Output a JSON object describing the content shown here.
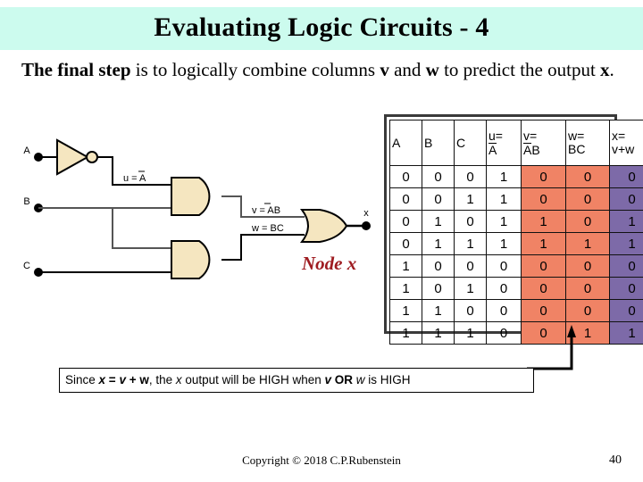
{
  "slide": {
    "title": "Evaluating Logic Circuits - 4",
    "title_bg": "#ccfbee",
    "body_text_part1": "The final step",
    "body_text_part2": " is to logically combine columns ",
    "body_text_v": "v",
    "body_text_part3": " and ",
    "body_text_w": "w",
    "body_text_part4": " to predict the output ",
    "body_text_x": "x",
    "body_text_period": "."
  },
  "circuit": {
    "inputs": [
      {
        "label": "A"
      },
      {
        "label": "B"
      },
      {
        "label": "C"
      }
    ],
    "wire_labels": {
      "u": "u = A",
      "v": "v = AB",
      "w": "w = BC"
    },
    "output_label": "x",
    "node_annotation": "Node x",
    "node_annotation_color": "#9e1b20",
    "gate_fill": "#f5e6c0",
    "gate_stroke": "#000000"
  },
  "truth_table": {
    "headers": [
      {
        "line1": "A",
        "line2": "",
        "overline": false,
        "plain": true
      },
      {
        "line1": "B",
        "line2": "",
        "overline": false,
        "plain": true
      },
      {
        "line1": "C",
        "line2": "",
        "overline": false,
        "plain": true
      },
      {
        "line1": "u=",
        "line2": "A",
        "overline": true,
        "plain": false
      },
      {
        "line1": "v=",
        "line2": "AB",
        "overline": true,
        "plain": false
      },
      {
        "line1": "w=",
        "line2": "BC",
        "overline": false,
        "plain": false
      },
      {
        "line1": "x=",
        "line2": "v+w",
        "overline": false,
        "plain": false
      }
    ],
    "rows": [
      [
        "0",
        "0",
        "0",
        "1",
        "0",
        "0",
        "0"
      ],
      [
        "0",
        "0",
        "1",
        "1",
        "0",
        "0",
        "0"
      ],
      [
        "0",
        "1",
        "0",
        "1",
        "1",
        "0",
        "1"
      ],
      [
        "0",
        "1",
        "1",
        "1",
        "1",
        "1",
        "1"
      ],
      [
        "1",
        "0",
        "0",
        "0",
        "0",
        "0",
        "0"
      ],
      [
        "1",
        "0",
        "1",
        "0",
        "0",
        "0",
        "0"
      ],
      [
        "1",
        "1",
        "0",
        "0",
        "0",
        "0",
        "0"
      ],
      [
        "1",
        "1",
        "1",
        "0",
        "0",
        "1",
        "1"
      ]
    ],
    "highlight_colors": {
      "v_column": "#f08365",
      "w_column": "#f08365",
      "x_column": "#7d6aa8"
    }
  },
  "caption": {
    "p1": "Since ",
    "x1": "x",
    "p2": " = ",
    "v1": "v",
    "p3": " + ",
    "w1": "w",
    "p4": ", the ",
    "x2": "x",
    "p5": " output will be HIGH when ",
    "v2": "v",
    "p6": " OR ",
    "w2": "w",
    "p7": " is HIGH"
  },
  "footer": {
    "copyright": "Copyright © 2018 C.P.Rubenstein",
    "page_number": "40"
  }
}
